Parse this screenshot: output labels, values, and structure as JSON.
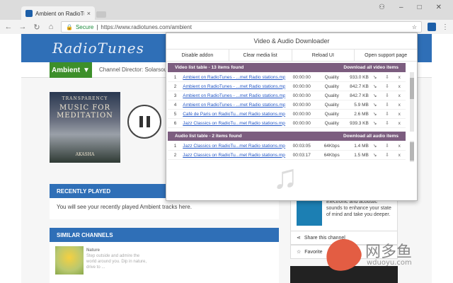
{
  "browser": {
    "tab_title": "Ambient on RadioTunes",
    "tab_close": "×",
    "window_controls": {
      "minimize": "–",
      "maximize": "□",
      "close": "✕",
      "profile": "⚇"
    },
    "nav": {
      "back": "←",
      "forward": "→",
      "reload": "↻",
      "home": "⌂"
    },
    "secure_label": "Secure",
    "url": "https://www.radiotunes.com/ambient",
    "bookmark_star": "☆",
    "menu_icon": "⋮"
  },
  "site": {
    "logo": "RadioTunes",
    "genre": "Ambient",
    "genre_caret": "▼",
    "director": "Channel Director: Solarsoul",
    "album": {
      "line1": "TRANSPARENCY",
      "line2": "MUSIC FOR MEDITATION",
      "artist": "AKASHA"
    },
    "recently_played_title": "RECENTLY PLAYED",
    "recently_played_text": "You will see your recently played Ambient tracks here.",
    "similar_title": "SIMILAR CHANNELS",
    "similar_channel": {
      "name": "Nature",
      "desc": "Step outside and admire the world around you. Dip in nature, drive to ..."
    },
    "side_desc": "Electronic and acoustic sounds to enhance your state of mind and take you deeper.",
    "share_label": "Share this channel",
    "favorite_label": "Favorite"
  },
  "popup": {
    "title": "Video & Audio Downloader",
    "buttons": [
      "Disable addon",
      "Clear media list",
      "Reload UI",
      "Open support page"
    ],
    "video_header": "Video list table - 13 items found",
    "video_download_all": "Download all video items",
    "audio_header": "Audio list table - 2 items found",
    "audio_download_all": "Download all audio items",
    "quality_label": "Quality",
    "video_rows": [
      {
        "n": "1",
        "file": "Ambient on RadioTunes - ...met Radio stations.mp4",
        "dur": "00:00:00",
        "q": "Quality",
        "size": "933.0 KB"
      },
      {
        "n": "2",
        "file": "Ambient on RadioTunes - ...met Radio stations.mp4",
        "dur": "00:00:00",
        "q": "Quality",
        "size": "842.7 KB"
      },
      {
        "n": "3",
        "file": "Ambient on RadioTunes - ...met Radio stations.mp4",
        "dur": "00:00:00",
        "q": "Quality",
        "size": "842.7 KB"
      },
      {
        "n": "4",
        "file": "Ambient on RadioTunes - ...met Radio stations.mp4",
        "dur": "00:00:00",
        "q": "Quality",
        "size": "5.9 MB"
      },
      {
        "n": "5",
        "file": "Café de Paris on RadioTu...met Radio stations.mp4",
        "dur": "00:00:00",
        "q": "Quality",
        "size": "2.6 MB"
      },
      {
        "n": "6",
        "file": "Jazz Classics on RadioTu...met Radio stations.mp4",
        "dur": "00:00:00",
        "q": "Quality",
        "size": "939.3 KB"
      }
    ],
    "audio_rows": [
      {
        "n": "1",
        "file": "Jazz Classics on RadioTu...met Radio stations.mp4",
        "dur": "00:03:05",
        "q": "64Kbps",
        "size": "1.4 MB"
      },
      {
        "n": "2",
        "file": "Jazz Classics on RadioTu...met Radio stations.mp4",
        "dur": "00:03:17",
        "q": "64Kbps",
        "size": "1.5 MB"
      }
    ],
    "row_icons": {
      "link": "↘",
      "download": "⇩",
      "remove": "x"
    },
    "music_note": "♫"
  },
  "watermark": {
    "text": "网多鱼",
    "url": "wduoyu.com"
  },
  "colors": {
    "header_blue": "#2f6fb7",
    "genre_green": "#3d8f2a",
    "popup_header": "#7c5d7f",
    "link": "#2256c6"
  }
}
